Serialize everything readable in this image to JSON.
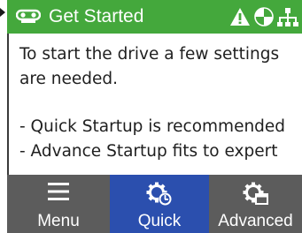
{
  "header": {
    "title": "Get Started",
    "title_icon": "drive-icon",
    "status_icons": [
      "warning-icon",
      "safety-icon",
      "network-icon"
    ],
    "background_color": "#44a83c"
  },
  "message": {
    "lines": [
      "To start the drive a few settings",
      "are needed.",
      "",
      "- Quick Startup is recommended",
      "- Advance Startup fits to expert"
    ]
  },
  "softkeys": [
    {
      "label": "Menu",
      "icon": "menu-icon",
      "color": "#5c5c5c",
      "selected": false
    },
    {
      "label": "Quick",
      "icon": "quick-setup-gear-icon",
      "color": "#2b4fae",
      "selected": true
    },
    {
      "label": "Advanced",
      "icon": "advanced-setup-gear-icon",
      "color": "#5c5c5c",
      "selected": false
    }
  ]
}
